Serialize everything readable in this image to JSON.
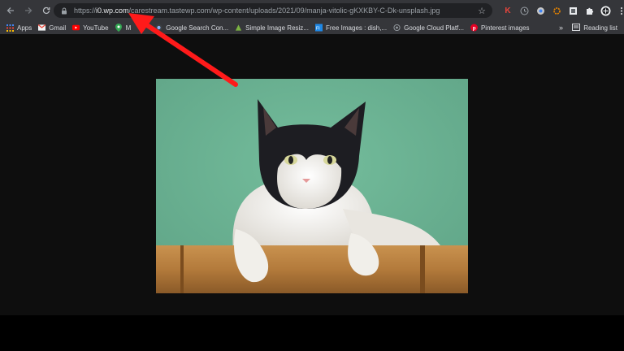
{
  "browser": {
    "url": {
      "scheme": "https://",
      "host": "i0.wp.com",
      "path": "/carestream.tastewp.com/wp-content/uploads/2021/09/manja-vitolic-gKXKBY-C-Dk-unsplash.jpg"
    },
    "extensions": [
      "k-extension-icon",
      "clock-extension-icon",
      "color-extension-icon",
      "gear-extension-icon",
      "square-extension-icon",
      "puzzle-icon",
      "profile-avatar",
      "menu-dots-icon"
    ]
  },
  "bookmarks": {
    "items": [
      {
        "label": "Apps",
        "icon": "apps-grid-icon"
      },
      {
        "label": "Gmail",
        "icon": "gmail-icon"
      },
      {
        "label": "YouTube",
        "icon": "youtube-icon"
      },
      {
        "label": "M",
        "icon": "maps-pin-icon"
      },
      {
        "label": "Google Search Con...",
        "icon": "search-console-icon"
      },
      {
        "label": "Simple Image Resiz...",
        "icon": "image-resizer-icon"
      },
      {
        "label": "Free Images : dish,...",
        "icon": "freeimages-icon"
      },
      {
        "label": "Google Cloud Platf...",
        "icon": "cloud-platform-icon"
      },
      {
        "label": "Pinterest images",
        "icon": "pinterest-icon"
      }
    ],
    "overflow": "»",
    "reading_list": "Reading list"
  },
  "colors": {
    "annotation_arrow": "#ff1a1a",
    "backdrop": "#6fb596"
  }
}
